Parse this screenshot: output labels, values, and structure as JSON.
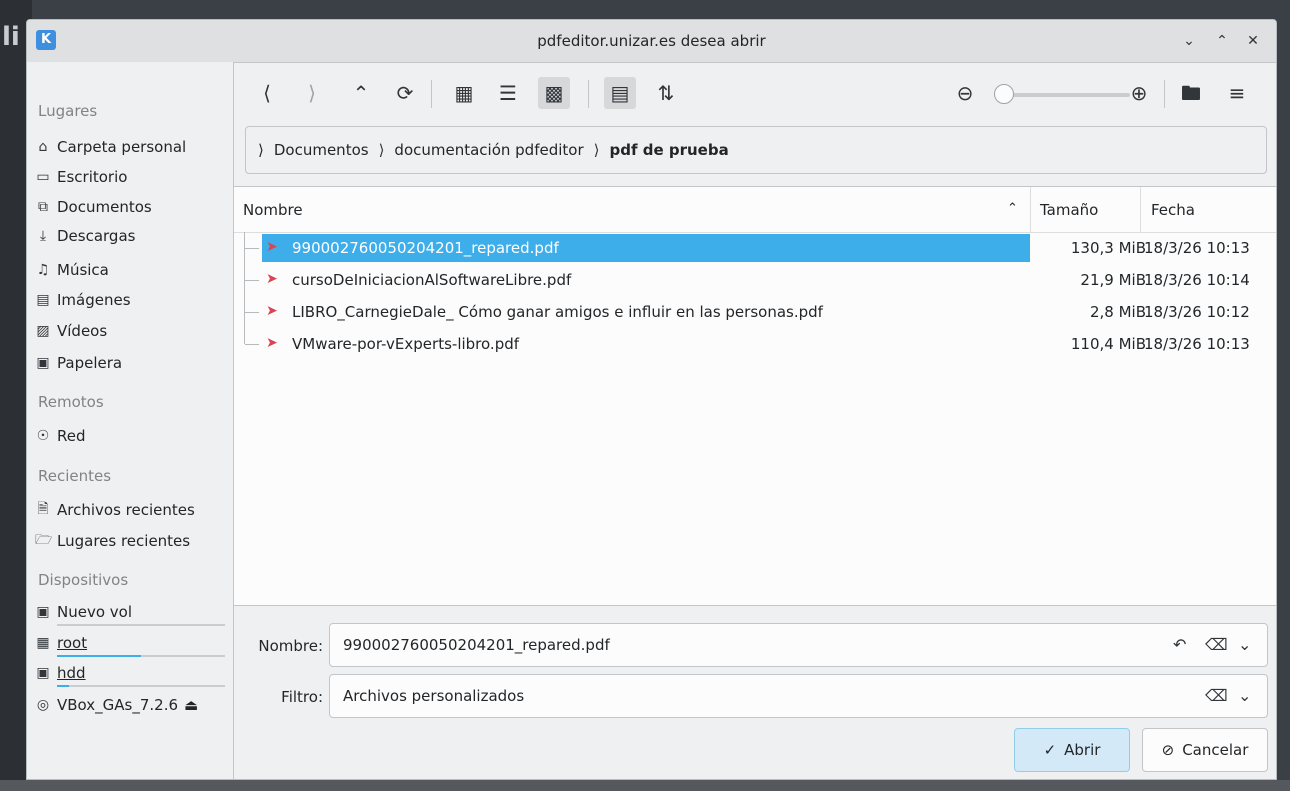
{
  "window": {
    "title": "pdfeditor.unizar.es desea abrir",
    "app_icon": "kde-icon"
  },
  "sidebar": {
    "sections": [
      {
        "title": "Lugares",
        "items": [
          {
            "label": "Carpeta personal",
            "icon": "home-icon"
          },
          {
            "label": "Escritorio",
            "icon": "desktop-icon"
          },
          {
            "label": "Documentos",
            "icon": "documents-icon"
          },
          {
            "label": "Descargas",
            "icon": "downloads-icon"
          },
          {
            "label": "Música",
            "icon": "music-icon"
          },
          {
            "label": "Imágenes",
            "icon": "pictures-icon"
          },
          {
            "label": "Vídeos",
            "icon": "videos-icon"
          },
          {
            "label": "Papelera",
            "icon": "trash-icon"
          }
        ]
      },
      {
        "title": "Remotos",
        "items": [
          {
            "label": "Red",
            "icon": "network-icon"
          }
        ]
      },
      {
        "title": "Recientes",
        "items": [
          {
            "label": "Archivos recientes",
            "icon": "recent-files-icon"
          },
          {
            "label": "Lugares recientes",
            "icon": "recent-places-icon"
          }
        ]
      },
      {
        "title": "Dispositivos",
        "items": [
          {
            "label": "Nuevo vol",
            "icon": "drive-icon",
            "usage": 0.0
          },
          {
            "label": "root",
            "icon": "root-drive-icon",
            "usage": 0.5
          },
          {
            "label": "hdd",
            "icon": "drive-icon",
            "usage": 0.07
          },
          {
            "label": "VBox_GAs_7.2.6",
            "icon": "optical-disc-icon"
          }
        ]
      }
    ]
  },
  "toolbar": {
    "zoom_level": 0.0,
    "active_view": "detailed-tree-view",
    "preview_active": true
  },
  "breadcrumb": {
    "parts": [
      "Documentos",
      "documentación pdfeditor"
    ],
    "current": "pdf de prueba"
  },
  "filelist": {
    "columns": {
      "name": "Nombre",
      "size": "Tamaño",
      "date": "Fecha"
    },
    "sort": "name-ascending",
    "rows": [
      {
        "name": "990002760050204201_repared.pdf",
        "size": "130,3 MiB",
        "date": "18/3/26 10:13",
        "selected": true
      },
      {
        "name": "cursoDeIniciacionAlSoftwareLibre.pdf",
        "size": "21,9 MiB",
        "date": "18/3/26 10:14",
        "selected": false
      },
      {
        "name": "LIBRO_CarnegieDale_ Cómo ganar amigos e influir en las personas.pdf",
        "size": "2,8 MiB",
        "date": "18/3/26 10:12",
        "selected": false
      },
      {
        "name": "VMware-por-vExperts-libro.pdf",
        "size": "110,4 MiB",
        "date": "18/3/26 10:13",
        "selected": false
      }
    ]
  },
  "name_field": {
    "label": "Nombre:",
    "value": "990002760050204201_repared.pdf"
  },
  "filter_field": {
    "label": "Filtro:",
    "value": "Archivos personalizados"
  },
  "buttons": {
    "open": "Abrir",
    "cancel": "Cancelar"
  },
  "colors": {
    "accent": "#3daee9",
    "pdf_icon": "#da4453",
    "window_bg": "#eff0f1"
  }
}
